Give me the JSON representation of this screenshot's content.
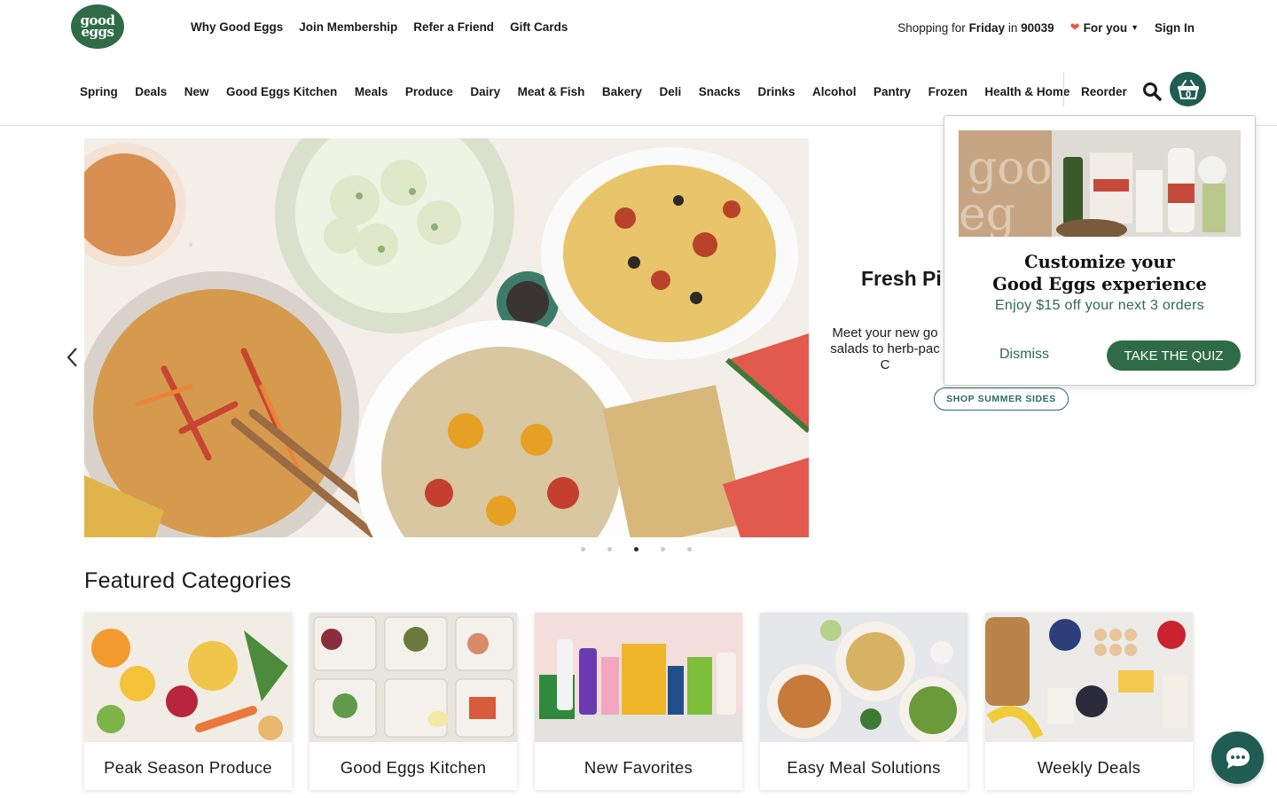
{
  "brand": {
    "logo_text": "good eggs"
  },
  "topbar": {
    "links": [
      "Why Good Eggs",
      "Join Membership",
      "Refer a Friend",
      "Gift Cards"
    ],
    "shopping_prefix": "Shopping for",
    "shopping_day": "Friday",
    "shopping_in": "in",
    "zip": "90039",
    "for_you": "For you",
    "sign_in": "Sign In"
  },
  "nav": {
    "items": [
      "Spring",
      "Deals",
      "New",
      "Good Eggs Kitchen",
      "Meals",
      "Produce",
      "Dairy",
      "Meat & Fish",
      "Bakery",
      "Deli",
      "Snacks",
      "Drinks",
      "Alcohol",
      "Pantry",
      "Frozen",
      "Health & Home"
    ],
    "reorder": "Reorder",
    "cart_count": "0"
  },
  "hero": {
    "title": "Fresh Pi",
    "description_lines": [
      "Meet your new go",
      "salads to herb-pac",
      "C"
    ],
    "button": "SHOP SUMMER SIDES",
    "active_slide": 3,
    "slide_count": 5
  },
  "popup": {
    "title_line1": "Customize your",
    "title_line2": "Good Eggs experience",
    "subtitle": "Enjoy $15 off your next 3 orders",
    "dismiss": "Dismiss",
    "cta": "TAKE THE QUIZ"
  },
  "featured": {
    "title": "Featured Categories",
    "categories": [
      "Peak Season Produce",
      "Good Eggs Kitchen",
      "New Favorites",
      "Easy Meal Solutions",
      "Weekly Deals"
    ]
  },
  "colors": {
    "brand_green": "#2f6b47",
    "teal": "#1f5d52",
    "heart": "#e8574b"
  }
}
